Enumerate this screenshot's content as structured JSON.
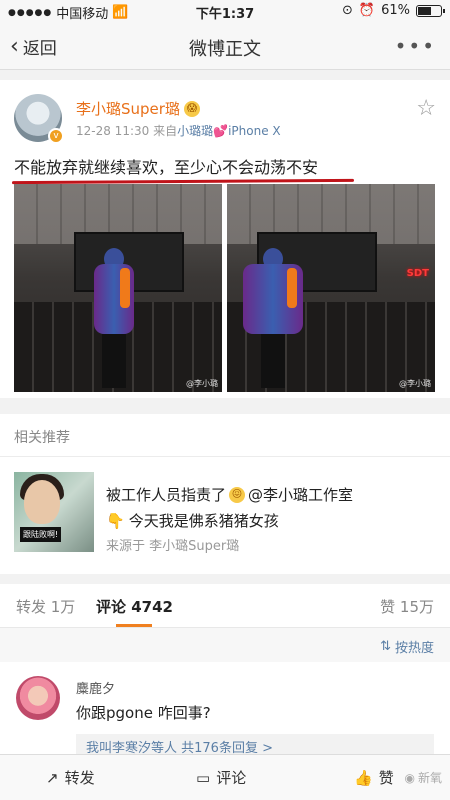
{
  "status_bar": {
    "carrier": "中国移动",
    "time": "下午1:37",
    "battery": "61%",
    "battery_level": 0.61
  },
  "nav": {
    "back_label": "返回",
    "title": "微博正文",
    "more_icon": "more-dots-icon"
  },
  "post": {
    "author": "李小璐Super璐",
    "time": "12-28 11:30",
    "source_prefix": "来自",
    "source_name": "小璐璐",
    "device": "iPhone X",
    "text": "不能放弃就继续喜欢，至少心不会动荡不安",
    "photo_watermark": "@李小璐"
  },
  "related": {
    "title": "相关推荐",
    "thumb_caption": "跟陆败啊!",
    "line1_a": "被工作人员指责了",
    "line1_b": "@李小璐工作室",
    "line2": "今天我是佛系猪猪女孩",
    "source": "来源于 李小璐Super璐"
  },
  "tabs": {
    "repost": "转发 1万",
    "comments_label": "评论",
    "comments_count": "4742",
    "likes": "赞 15万"
  },
  "sort": {
    "label": "按热度"
  },
  "comment": {
    "user": "麋鹿夕",
    "text": "你跟pgone 咋回事?",
    "reply_summary": "我叫李寒汐等人 共176条回复 >"
  },
  "bottom_bar": {
    "repost": "转发",
    "comment": "评论",
    "like": "赞",
    "watermark": "新氧"
  }
}
